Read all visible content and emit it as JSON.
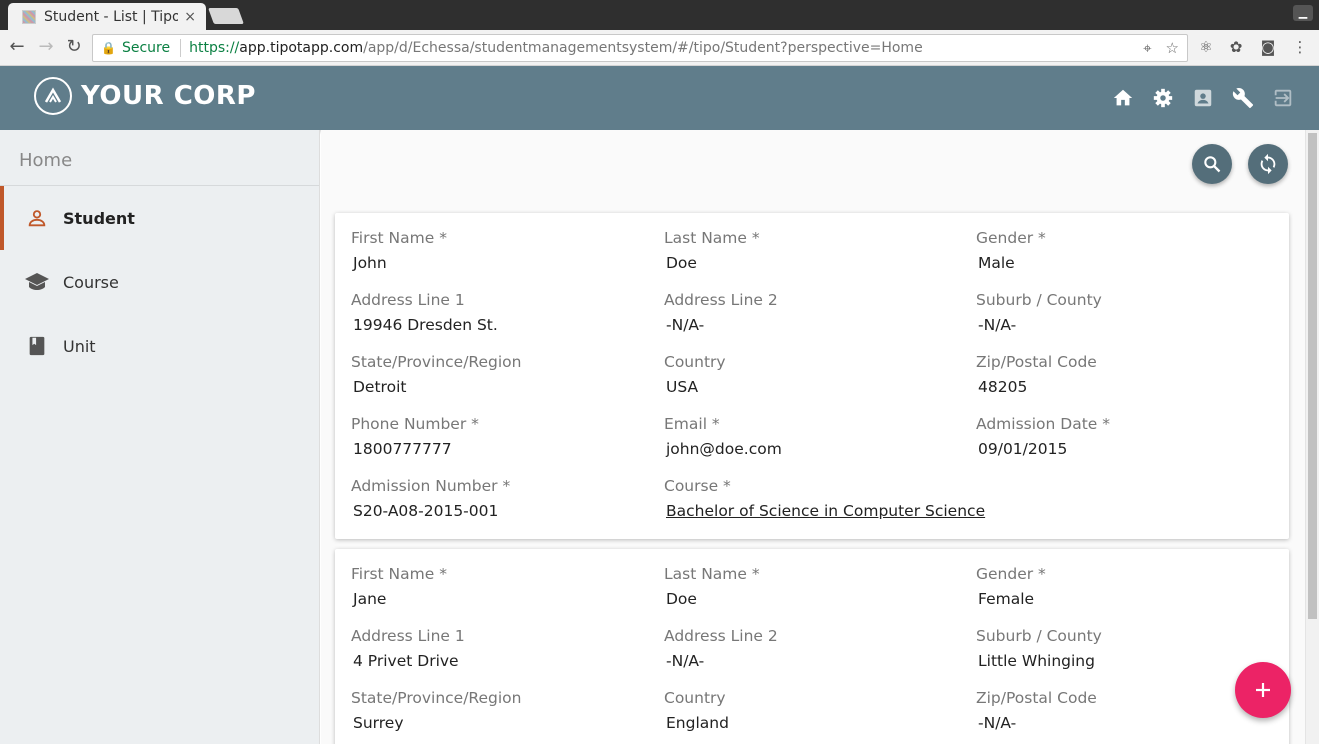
{
  "browser": {
    "tab_title": "Student - List | Tipo",
    "tab_close": "×",
    "secure_label": "Secure",
    "url_scheme": "https://",
    "url_host": "app.tipotapp.com",
    "url_path": "/app/d/Echessa/studentmanagementsystem/#/tipo/Student?perspective=Home"
  },
  "app": {
    "brand": "YOUR CORP",
    "header_icons": [
      "home-icon",
      "settings-icon",
      "account-box-icon",
      "wrench-icon",
      "logout-icon"
    ]
  },
  "sidebar": {
    "home": "Home",
    "items": [
      {
        "label": "Student",
        "icon": "person-icon",
        "active": true
      },
      {
        "label": "Course",
        "icon": "school-icon",
        "active": false
      },
      {
        "label": "Unit",
        "icon": "book-icon",
        "active": false
      }
    ]
  },
  "colors": {
    "appbar": "#607d8b",
    "active_accent": "#c0582a",
    "fab": "#ec2366",
    "action_button": "#546e7a"
  },
  "cards": [
    {
      "fields": [
        {
          "label": "First Name *",
          "value": "John"
        },
        {
          "label": "Last Name *",
          "value": "Doe"
        },
        {
          "label": "Gender *",
          "value": "Male"
        },
        {
          "label": "Address Line 1",
          "value": "19946 Dresden St."
        },
        {
          "label": "Address Line 2",
          "value": "-N/A-"
        },
        {
          "label": "Suburb / County",
          "value": "-N/A-"
        },
        {
          "label": "State/Province/Region",
          "value": "Detroit"
        },
        {
          "label": "Country",
          "value": "USA"
        },
        {
          "label": "Zip/Postal Code",
          "value": "48205"
        },
        {
          "label": "Phone Number *",
          "value": "1800777777"
        },
        {
          "label": "Email *",
          "value": "john@doe.com"
        },
        {
          "label": "Admission Date *",
          "value": "09/01/2015"
        },
        {
          "label": "Admission Number *",
          "value": "S20-A08-2015-001"
        },
        {
          "label": "Course *",
          "value": "Bachelor of Science in Computer Science"
        }
      ]
    },
    {
      "fields": [
        {
          "label": "First Name *",
          "value": "Jane"
        },
        {
          "label": "Last Name *",
          "value": "Doe"
        },
        {
          "label": "Gender *",
          "value": "Female"
        },
        {
          "label": "Address Line 1",
          "value": "4 Privet Drive"
        },
        {
          "label": "Address Line 2",
          "value": "-N/A-"
        },
        {
          "label": "Suburb / County",
          "value": "Little Whinging"
        },
        {
          "label": "State/Province/Region",
          "value": "Surrey"
        },
        {
          "label": "Country",
          "value": "England"
        },
        {
          "label": "Zip/Postal Code",
          "value": "-N/A-"
        }
      ]
    }
  ]
}
